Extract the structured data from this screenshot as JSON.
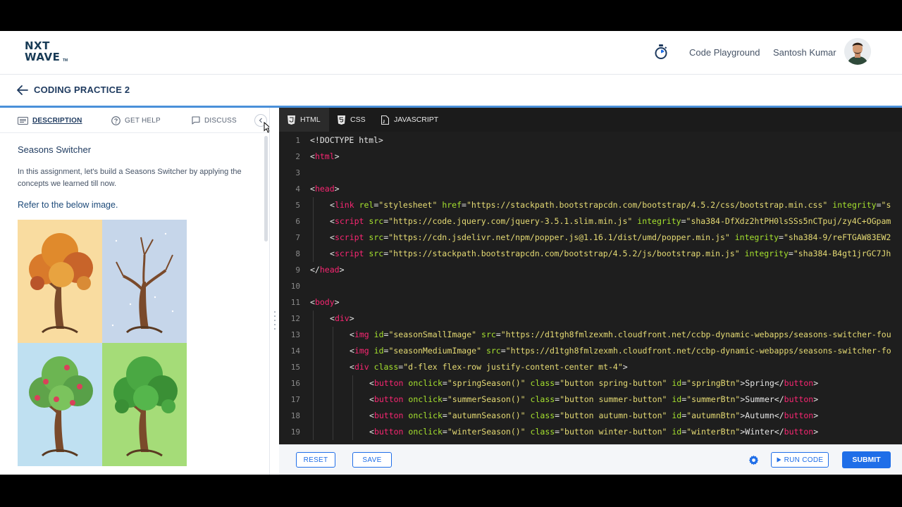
{
  "header": {
    "logo_line1": "NXT",
    "logo_line2": "WAVE",
    "logo_tm": "TM",
    "timer_icon": "stopwatch-icon",
    "nav_link": "Code Playground",
    "user_name": "Santosh Kumar"
  },
  "titlebar": {
    "back_icon": "arrow-left-icon",
    "title": "CODING PRACTICE 2"
  },
  "left_panel": {
    "tabs": [
      {
        "label": "DESCRIPTION",
        "icon": "description-icon",
        "active": true
      },
      {
        "label": "GET HELP",
        "icon": "help-circle-icon",
        "active": false
      },
      {
        "label": "DISCUSS",
        "icon": "chat-icon",
        "active": false
      }
    ],
    "collapse_icon": "chevron-left-icon",
    "heading": "Seasons Switcher",
    "paragraph": "In this assignment, let's build a Seasons Switcher by applying the concepts we learned till now.",
    "refer": "Refer to the below image."
  },
  "editor": {
    "tabs": [
      {
        "label": "HTML",
        "icon": "html5-icon",
        "active": true
      },
      {
        "label": "CSS",
        "icon": "css3-icon",
        "active": false
      },
      {
        "label": "JAVASCRIPT",
        "icon": "js-file-icon",
        "active": false
      }
    ],
    "lines": [
      {
        "n": "1",
        "indent": 0,
        "tokens": [
          [
            "p",
            "<!DOCTYPE html>"
          ]
        ]
      },
      {
        "n": "2",
        "indent": 0,
        "tokens": [
          [
            "p",
            "<"
          ],
          [
            "t",
            "html"
          ],
          [
            "p",
            ">"
          ]
        ]
      },
      {
        "n": "3",
        "indent": 0,
        "tokens": []
      },
      {
        "n": "4",
        "indent": 0,
        "tokens": [
          [
            "p",
            "<"
          ],
          [
            "t",
            "head"
          ],
          [
            "p",
            ">"
          ]
        ]
      },
      {
        "n": "5",
        "indent": 1,
        "tokens": [
          [
            "p",
            "<"
          ],
          [
            "t",
            "link"
          ],
          [
            "p",
            " "
          ],
          [
            "a",
            "rel"
          ],
          [
            "p",
            "="
          ],
          [
            "s",
            "\"stylesheet\""
          ],
          [
            "p",
            " "
          ],
          [
            "a",
            "href"
          ],
          [
            "p",
            "="
          ],
          [
            "s",
            "\"https://stackpath.bootstrapcdn.com/bootstrap/4.5.2/css/bootstrap.min.css\""
          ],
          [
            "p",
            " "
          ],
          [
            "a",
            "integrity"
          ],
          [
            "p",
            "="
          ],
          [
            "s",
            "\"s"
          ]
        ]
      },
      {
        "n": "6",
        "indent": 1,
        "tokens": [
          [
            "p",
            "<"
          ],
          [
            "t",
            "script"
          ],
          [
            "p",
            " "
          ],
          [
            "a",
            "src"
          ],
          [
            "p",
            "="
          ],
          [
            "s",
            "\"https://code.jquery.com/jquery-3.5.1.slim.min.js\""
          ],
          [
            "p",
            " "
          ],
          [
            "a",
            "integrity"
          ],
          [
            "p",
            "="
          ],
          [
            "s",
            "\"sha384-DfXdz2htPH0lsSSs5nCTpuj/zy4C+OGpam"
          ]
        ]
      },
      {
        "n": "7",
        "indent": 1,
        "tokens": [
          [
            "p",
            "<"
          ],
          [
            "t",
            "script"
          ],
          [
            "p",
            " "
          ],
          [
            "a",
            "src"
          ],
          [
            "p",
            "="
          ],
          [
            "s",
            "\"https://cdn.jsdelivr.net/npm/popper.js@1.16.1/dist/umd/popper.min.js\""
          ],
          [
            "p",
            " "
          ],
          [
            "a",
            "integrity"
          ],
          [
            "p",
            "="
          ],
          [
            "s",
            "\"sha384-9/reFTGAW83EW2"
          ]
        ]
      },
      {
        "n": "8",
        "indent": 1,
        "tokens": [
          [
            "p",
            "<"
          ],
          [
            "t",
            "script"
          ],
          [
            "p",
            " "
          ],
          [
            "a",
            "src"
          ],
          [
            "p",
            "="
          ],
          [
            "s",
            "\"https://stackpath.bootstrapcdn.com/bootstrap/4.5.2/js/bootstrap.min.js\""
          ],
          [
            "p",
            " "
          ],
          [
            "a",
            "integrity"
          ],
          [
            "p",
            "="
          ],
          [
            "s",
            "\"sha384-B4gt1jrGC7Jh"
          ]
        ]
      },
      {
        "n": "9",
        "indent": 0,
        "tokens": [
          [
            "p",
            "</"
          ],
          [
            "t",
            "head"
          ],
          [
            "p",
            ">"
          ]
        ]
      },
      {
        "n": "10",
        "indent": 0,
        "tokens": []
      },
      {
        "n": "11",
        "indent": 0,
        "tokens": [
          [
            "p",
            "<"
          ],
          [
            "t",
            "body"
          ],
          [
            "p",
            ">"
          ]
        ]
      },
      {
        "n": "12",
        "indent": 1,
        "tokens": [
          [
            "p",
            "<"
          ],
          [
            "t",
            "div"
          ],
          [
            "p",
            ">"
          ]
        ]
      },
      {
        "n": "13",
        "indent": 2,
        "tokens": [
          [
            "p",
            "<"
          ],
          [
            "t",
            "img"
          ],
          [
            "p",
            " "
          ],
          [
            "a",
            "id"
          ],
          [
            "p",
            "="
          ],
          [
            "s",
            "\"seasonSmallImage\""
          ],
          [
            "p",
            " "
          ],
          [
            "a",
            "src"
          ],
          [
            "p",
            "="
          ],
          [
            "s",
            "\"https://d1tgh8fmlzexmh.cloudfront.net/ccbp-dynamic-webapps/seasons-switcher-fou"
          ]
        ]
      },
      {
        "n": "14",
        "indent": 2,
        "tokens": [
          [
            "p",
            "<"
          ],
          [
            "t",
            "img"
          ],
          [
            "p",
            " "
          ],
          [
            "a",
            "id"
          ],
          [
            "p",
            "="
          ],
          [
            "s",
            "\"seasonMediumImage\""
          ],
          [
            "p",
            " "
          ],
          [
            "a",
            "src"
          ],
          [
            "p",
            "="
          ],
          [
            "s",
            "\"https://d1tgh8fmlzexmh.cloudfront.net/ccbp-dynamic-webapps/seasons-switcher-fo"
          ]
        ]
      },
      {
        "n": "15",
        "indent": 2,
        "tokens": [
          [
            "p",
            "<"
          ],
          [
            "t",
            "div"
          ],
          [
            "p",
            " "
          ],
          [
            "a",
            "class"
          ],
          [
            "p",
            "="
          ],
          [
            "s",
            "\"d-flex flex-row justify-content-center mt-4\""
          ],
          [
            "p",
            ">"
          ]
        ]
      },
      {
        "n": "16",
        "indent": 3,
        "tokens": [
          [
            "p",
            "<"
          ],
          [
            "t",
            "button"
          ],
          [
            "p",
            " "
          ],
          [
            "a",
            "onclick"
          ],
          [
            "p",
            "="
          ],
          [
            "s",
            "\"springSeason()\""
          ],
          [
            "p",
            " "
          ],
          [
            "a",
            "class"
          ],
          [
            "p",
            "="
          ],
          [
            "s",
            "\"button spring-button\""
          ],
          [
            "p",
            " "
          ],
          [
            "a",
            "id"
          ],
          [
            "p",
            "="
          ],
          [
            "s",
            "\"springBtn\""
          ],
          [
            "p",
            ">Spring</"
          ],
          [
            "t",
            "button"
          ],
          [
            "p",
            ">"
          ]
        ]
      },
      {
        "n": "17",
        "indent": 3,
        "tokens": [
          [
            "p",
            "<"
          ],
          [
            "t",
            "button"
          ],
          [
            "p",
            " "
          ],
          [
            "a",
            "onclick"
          ],
          [
            "p",
            "="
          ],
          [
            "s",
            "\"summerSeason()\""
          ],
          [
            "p",
            " "
          ],
          [
            "a",
            "class"
          ],
          [
            "p",
            "="
          ],
          [
            "s",
            "\"button summer-button\""
          ],
          [
            "p",
            " "
          ],
          [
            "a",
            "id"
          ],
          [
            "p",
            "="
          ],
          [
            "s",
            "\"summerBtn\""
          ],
          [
            "p",
            ">Summer</"
          ],
          [
            "t",
            "button"
          ],
          [
            "p",
            ">"
          ]
        ]
      },
      {
        "n": "18",
        "indent": 3,
        "tokens": [
          [
            "p",
            "<"
          ],
          [
            "t",
            "button"
          ],
          [
            "p",
            " "
          ],
          [
            "a",
            "onclick"
          ],
          [
            "p",
            "="
          ],
          [
            "s",
            "\"autumnSeason()\""
          ],
          [
            "p",
            " "
          ],
          [
            "a",
            "class"
          ],
          [
            "p",
            "="
          ],
          [
            "s",
            "\"button autumn-button\""
          ],
          [
            "p",
            " "
          ],
          [
            "a",
            "id"
          ],
          [
            "p",
            "="
          ],
          [
            "s",
            "\"autumnBtn\""
          ],
          [
            "p",
            ">Autumn</"
          ],
          [
            "t",
            "button"
          ],
          [
            "p",
            ">"
          ]
        ]
      },
      {
        "n": "19",
        "indent": 3,
        "tokens": [
          [
            "p",
            "<"
          ],
          [
            "t",
            "button"
          ],
          [
            "p",
            " "
          ],
          [
            "a",
            "onclick"
          ],
          [
            "p",
            "="
          ],
          [
            "s",
            "\"winterSeason()\""
          ],
          [
            "p",
            " "
          ],
          [
            "a",
            "class"
          ],
          [
            "p",
            "="
          ],
          [
            "s",
            "\"button winter-button\""
          ],
          [
            "p",
            " "
          ],
          [
            "a",
            "id"
          ],
          [
            "p",
            "="
          ],
          [
            "s",
            "\"winterBtn\""
          ],
          [
            "p",
            ">Winter</"
          ],
          [
            "t",
            "button"
          ],
          [
            "p",
            ">"
          ]
        ]
      }
    ]
  },
  "footer": {
    "reset": "RESET",
    "save": "SAVE",
    "settings_icon": "gear-icon",
    "run": "RUN CODE",
    "run_icon": "play-icon",
    "submit": "SUBMIT"
  },
  "colors": {
    "primary": "#1f6ee8",
    "editor_bg": "#1e1e1e",
    "tag": "#f92672",
    "attr": "#a6e22e",
    "string": "#e6db74"
  }
}
